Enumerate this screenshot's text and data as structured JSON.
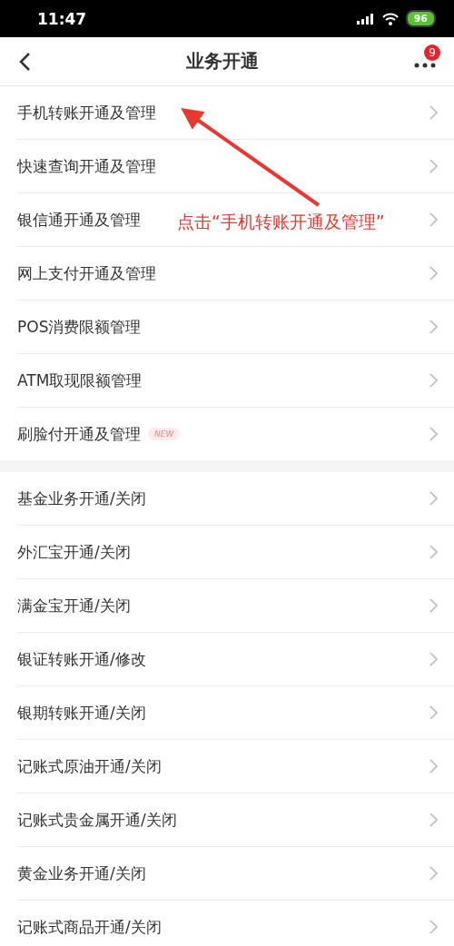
{
  "status_bar": {
    "time": "11:47",
    "battery": "96"
  },
  "header": {
    "title": "业务开通",
    "badge": "9"
  },
  "groups": [
    {
      "items": [
        {
          "label": "手机转账开通及管理"
        },
        {
          "label": "快速查询开通及管理"
        },
        {
          "label": "银信通开通及管理"
        },
        {
          "label": "网上支付开通及管理"
        },
        {
          "label": "POS消费限额管理"
        },
        {
          "label": "ATM取现限额管理"
        },
        {
          "label": "刷脸付开通及管理",
          "tag": "NEW"
        }
      ]
    },
    {
      "items": [
        {
          "label": "基金业务开通/关闭"
        },
        {
          "label": "外汇宝开通/关闭"
        },
        {
          "label": "满金宝开通/关闭"
        },
        {
          "label": "银证转账开通/修改"
        },
        {
          "label": "银期转账开通/关闭"
        },
        {
          "label": "记账式原油开通/关闭"
        },
        {
          "label": "记账式贵金属开通/关闭"
        },
        {
          "label": "黄金业务开通/关闭"
        },
        {
          "label": "记账式商品开通/关闭"
        }
      ]
    }
  ],
  "annotation": {
    "text": "点击“手机转账开通及管理”"
  }
}
